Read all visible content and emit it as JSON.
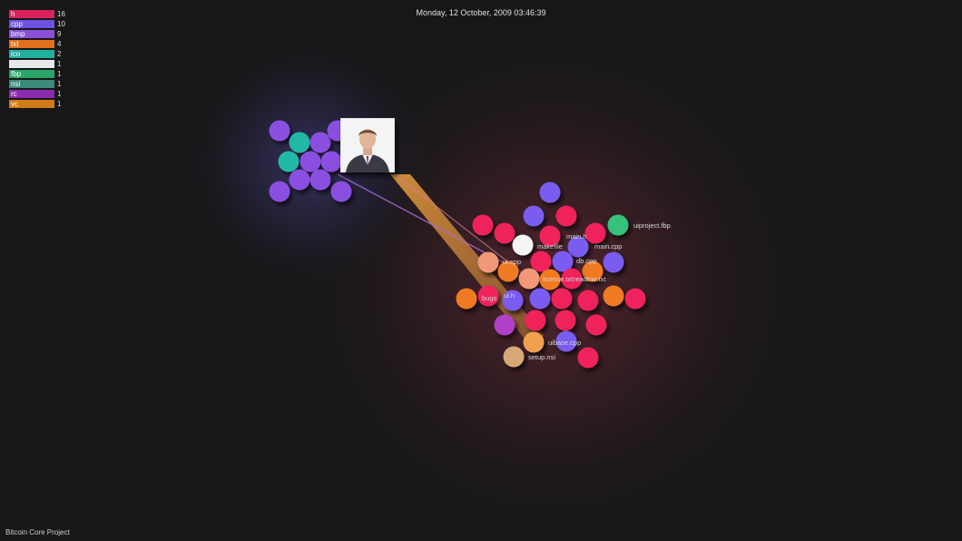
{
  "header": {
    "date": "Monday, 12 October, 2009 03:46:39"
  },
  "footer": {
    "project_title": "Bitcoin Core Project"
  },
  "legend": [
    {
      "ext": "h",
      "count": "16",
      "color": "#d8245a"
    },
    {
      "ext": "cpp",
      "count": "10",
      "color": "#6c52e0"
    },
    {
      "ext": "bmp",
      "count": "9",
      "color": "#8a4fd6"
    },
    {
      "ext": "txt",
      "count": "4",
      "color": "#e0701e"
    },
    {
      "ext": "ico",
      "count": "2",
      "color": "#1fb0a0"
    },
    {
      "ext": "",
      "count": "1",
      "color": "#e8e8e8"
    },
    {
      "ext": "fbp",
      "count": "1",
      "color": "#2aa66a"
    },
    {
      "ext": "nsi",
      "count": "1",
      "color": "#3e8a78"
    },
    {
      "ext": "rc",
      "count": "1",
      "color": "#8a2cb0"
    },
    {
      "ext": "vc",
      "count": "1",
      "color": "#d07a18"
    }
  ],
  "file_labels": {
    "uiproject": "uiproject.fbp",
    "main_h": "main.h",
    "makefile": "makefile",
    "main_cpp": "main.cpp",
    "ui_cpp": "ui.cpp",
    "db_cpp": "db.cpp",
    "license": "license.txt",
    "readme": "readme.txt",
    "bugs": "bugs",
    "ui_h": "ui.h",
    "uibase_cpp": "uibase.cpp",
    "setup_nsi": "setup.nsi"
  },
  "colors": {
    "h": "#f0245c",
    "cpp": "#7a5cf0",
    "bmp": "#8a4fe0",
    "txt": "#f07a22",
    "ico": "#22b8a6",
    "none": "#f4f4f4",
    "fbp": "#34c27a",
    "nsi": "#d6a878",
    "rc": "#b040c8",
    "vc": "#f0a050",
    "peach": "#f09878",
    "beam": "#f0a040"
  },
  "user": {
    "avatar": "person-portrait-icon"
  }
}
